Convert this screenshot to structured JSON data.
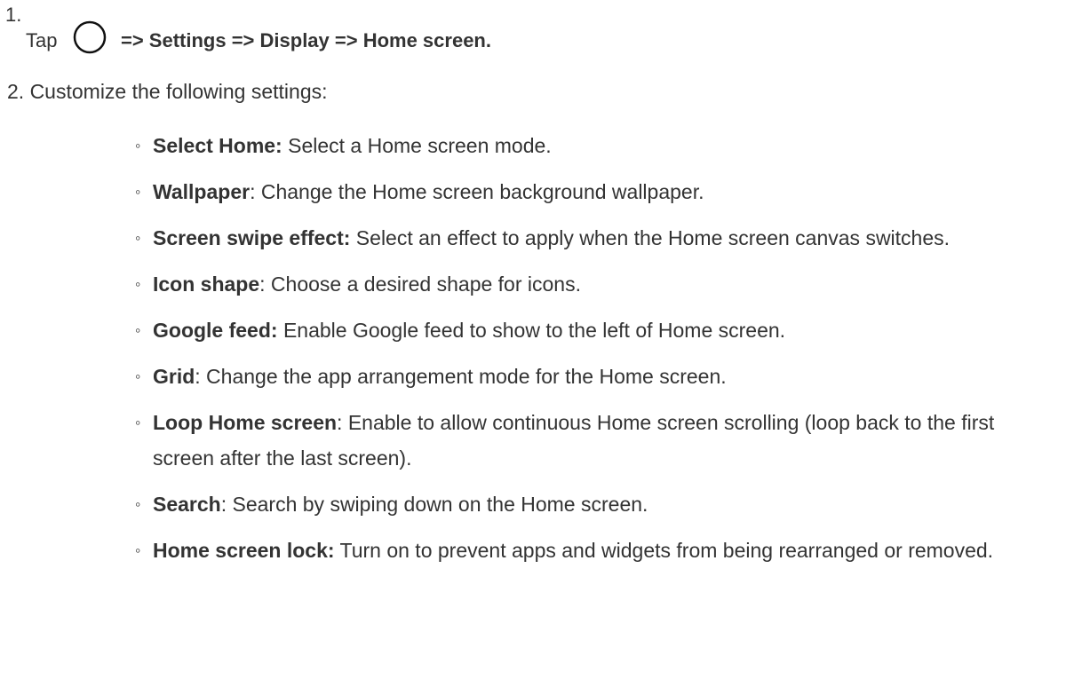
{
  "step1": {
    "number": "1.",
    "tap": "Tap",
    "icon": "home-circle-icon",
    "path": "=> Settings => Display => Home screen."
  },
  "step2": {
    "text": "2. Customize the following settings:"
  },
  "settings": [
    {
      "term": "Select Home:",
      "desc": " Select a Home screen mode."
    },
    {
      "term": "Wallpaper",
      "desc": ": Change the Home screen background wallpaper."
    },
    {
      "term": "Screen swipe effect:",
      "desc": " Select an effect to apply when the Home screen canvas switches."
    },
    {
      "term": "Icon shape",
      "desc": ": Choose a desired shape for icons."
    },
    {
      "term": "Google feed:",
      "desc": " Enable Google feed to show to the left of Home screen."
    },
    {
      "term": "Grid",
      "desc": ": Change the app arrangement mode for the Home screen."
    },
    {
      "term": "Loop Home screen",
      "desc": ": Enable to allow continuous Home screen scrolling (loop back to the first screen after the last screen)."
    },
    {
      "term": "Search",
      "desc": ": Search by swiping down on the Home screen."
    },
    {
      "term": "Home screen lock:",
      "desc": " Turn on to prevent apps and widgets from being rearranged or removed."
    }
  ],
  "bullet_glyph": "◦"
}
